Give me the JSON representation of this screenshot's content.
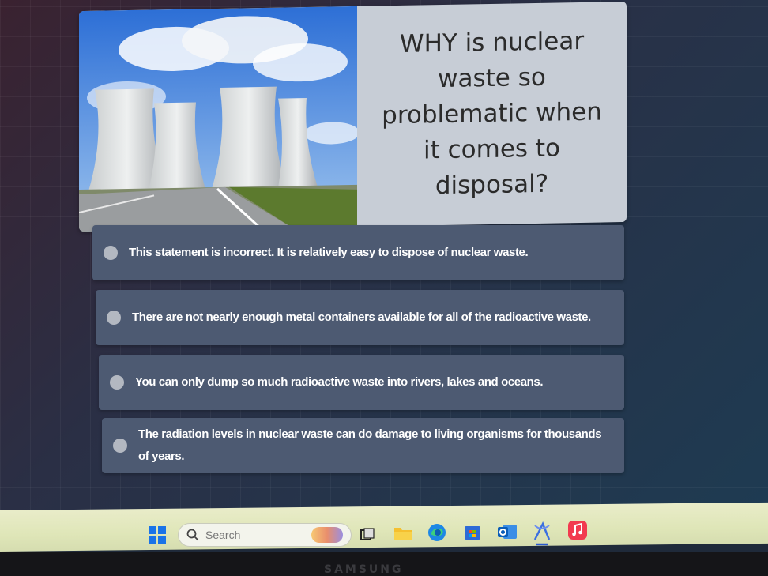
{
  "question": {
    "text": "WHY is nuclear waste so problematic when it comes to disposal?"
  },
  "answers": [
    "This statement is incorrect. It is relatively easy to dispose of nuclear waste.",
    "There are not nearly enough metal containers available for all of the radioactive waste.",
    "You can only dump so much radioactive waste into rivers, lakes and oceans.",
    "The radiation levels in nuclear waste can do damage to living organisms for thousands of years."
  ],
  "taskbar": {
    "search_placeholder": "Search",
    "apps": [
      "windows-start",
      "search",
      "task-view",
      "file-explorer",
      "edge",
      "store",
      "outlook",
      "math-app",
      "music"
    ]
  },
  "bezel": {
    "brand": "SAMSUNG"
  },
  "colors": {
    "answer_bg": "#4d5a72",
    "card_bg": "#c7cdd6",
    "taskbar_bg": "#e0e6bb"
  }
}
